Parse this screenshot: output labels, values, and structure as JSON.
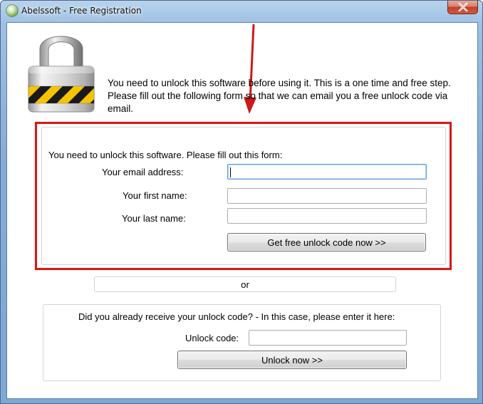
{
  "window": {
    "title": "Abelssoft - Free Registration"
  },
  "intro_text": "You need to unlock this software before using it. This is a one time and free step. Please fill out the following form so that we can email you a free unlock code via email.",
  "form": {
    "heading": "You need to unlock this software. Please fill out this form:",
    "email_label": "Your email address:",
    "email_value": "",
    "first_name_label": "Your first name:",
    "first_name_value": "",
    "last_name_label": "Your last name:",
    "last_name_value": "",
    "submit_label": "Get free unlock code now >>"
  },
  "or_text": "or",
  "unlock": {
    "heading": "Did you already receive your unlock code? - In this case, please enter it here:",
    "code_label": "Unlock code:",
    "code_value": "",
    "button_label": "Unlock now >>"
  },
  "colors": {
    "highlight_box": "#d91818",
    "arrow": "#cc1a1a",
    "focus_border": "#569de5"
  },
  "icons": {
    "window_icon": "app-orb-icon",
    "close": "close-icon",
    "lock": "padlock-icon"
  }
}
